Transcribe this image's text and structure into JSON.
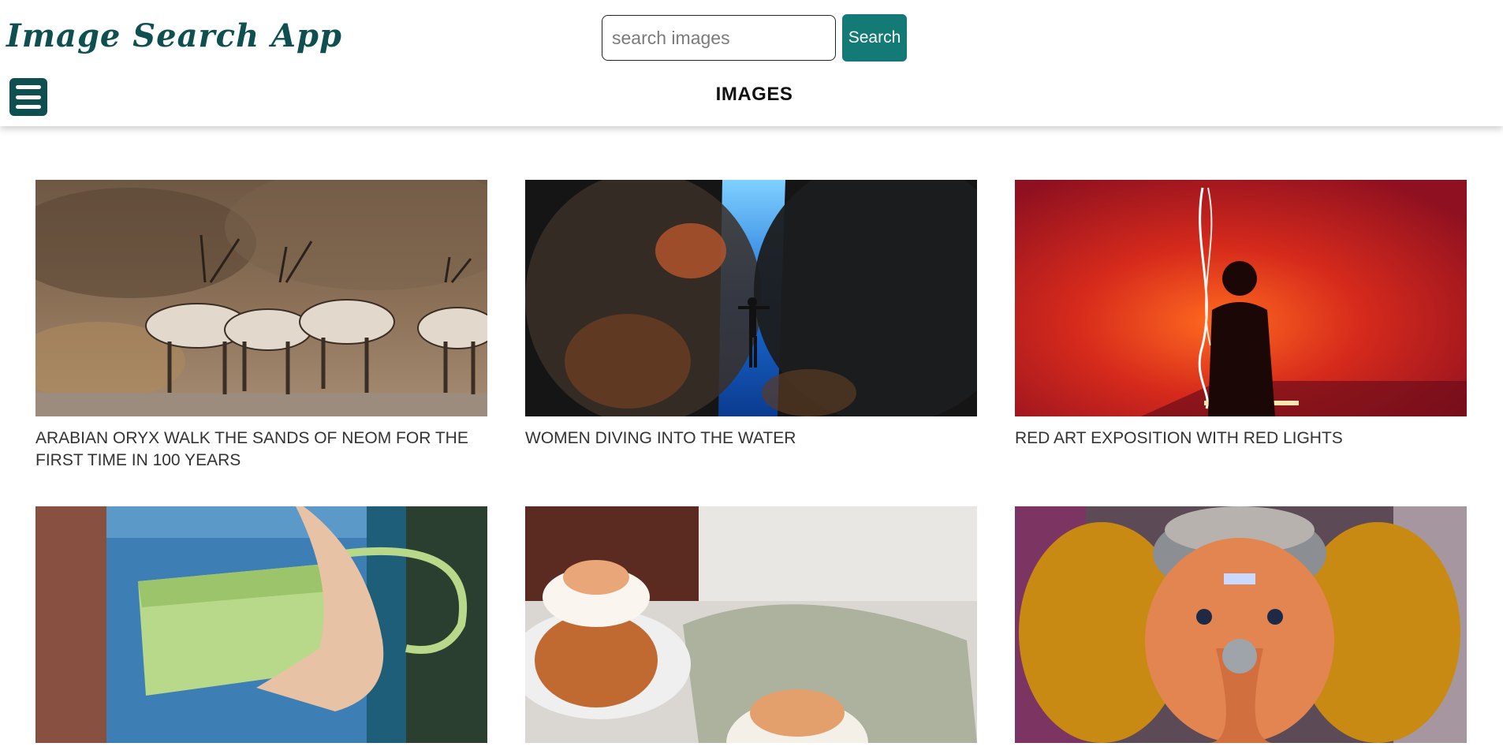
{
  "app": {
    "title": "Image Search App"
  },
  "search": {
    "placeholder": "search images",
    "value": "",
    "button_label": "Search"
  },
  "menu": {
    "icon": "hamburger-menu-icon"
  },
  "section": {
    "title": "IMAGES"
  },
  "images": [
    {
      "caption": "ARABIAN ORYX WALK THE SANDS OF NEOM FOR THE FIRST TIME IN 100 YEARS"
    },
    {
      "caption": "WOMEN DIVING INTO THE WATER"
    },
    {
      "caption": "RED ART EXPOSITION WITH RED LIGHTS"
    },
    {
      "caption": ""
    },
    {
      "caption": ""
    },
    {
      "caption": ""
    }
  ],
  "colors": {
    "brand": "#0f4f4f",
    "accent": "#137a76",
    "text": "#333333"
  }
}
